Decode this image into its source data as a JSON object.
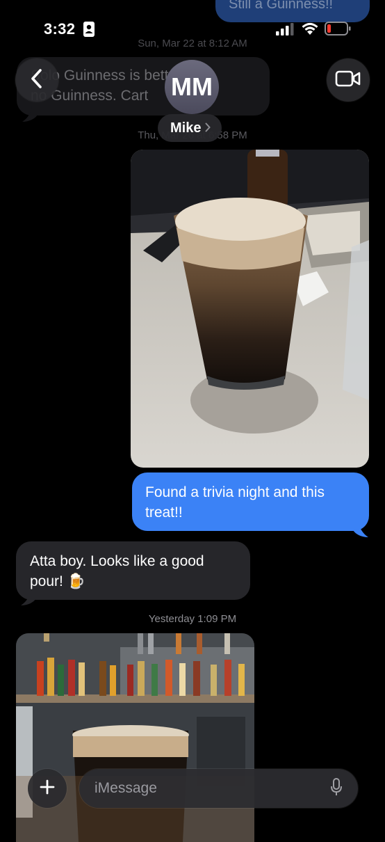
{
  "status_bar": {
    "time": "3:32"
  },
  "header": {
    "avatar_initials": "MM",
    "contact_name": "Mike"
  },
  "thread": {
    "top_outgoing_partial": "Still a Guinness!!",
    "timestamp_1": "Sun, Mar 22 at 8:12 AM",
    "incoming_1_line1": "Solo Guinness is better than",
    "incoming_1_line2": "no Guinness.  Cart",
    "timestamp_2": "Thu, Mar 26 at 6:58 PM",
    "outgoing_1": "Found a trivia night and this treat!!",
    "incoming_2": "Atta boy.  Looks like a good pour! 🍺",
    "timestamp_3": "Yesterday 1:09 PM"
  },
  "composer": {
    "placeholder": "iMessage"
  },
  "colors": {
    "outgoing_bubble": "#3b82f6",
    "incoming_bubble": "#26262a",
    "battery_low": "#ff3b30"
  },
  "icons": [
    "back-chevron-icon",
    "video-camera-icon",
    "plus-icon",
    "microphone-icon",
    "signal-icon",
    "wifi-icon",
    "battery-icon",
    "contact-card-icon"
  ]
}
